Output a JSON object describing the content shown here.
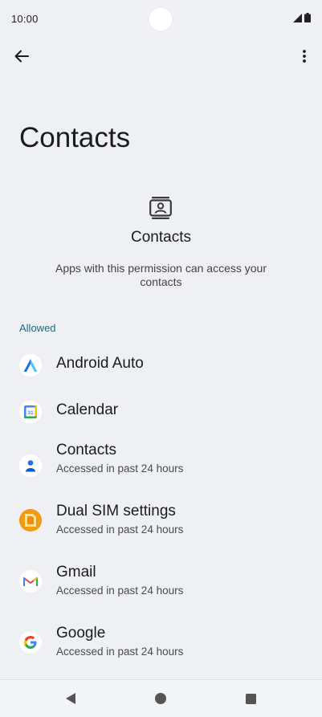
{
  "status_bar": {
    "time": "10:00"
  },
  "page": {
    "title": "Contacts",
    "header_title": "Contacts",
    "header_description": "Apps with this permission can access your contacts",
    "section_label": "Allowed"
  },
  "apps": [
    {
      "name": "Android Auto",
      "subtitle": "",
      "icon": "android-auto-icon"
    },
    {
      "name": "Calendar",
      "subtitle": "",
      "icon": "calendar-icon"
    },
    {
      "name": "Contacts",
      "subtitle": "Accessed in past 24 hours",
      "icon": "contacts-app-icon"
    },
    {
      "name": "Dual SIM settings",
      "subtitle": "Accessed in past 24 hours",
      "icon": "dual-sim-icon"
    },
    {
      "name": "Gmail",
      "subtitle": "Accessed in past 24 hours",
      "icon": "gmail-icon"
    },
    {
      "name": "Google",
      "subtitle": "Accessed in past 24 hours",
      "icon": "google-icon"
    }
  ],
  "colors": {
    "background": "#eef0f3",
    "accent": "#1f6a82"
  }
}
